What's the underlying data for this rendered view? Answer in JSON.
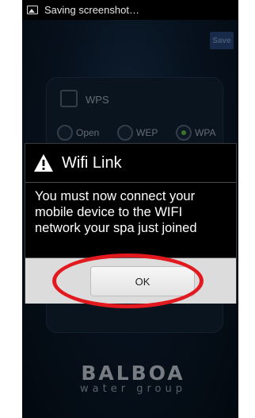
{
  "status_bar": {
    "text": "Saving screenshot…",
    "icon": "screenshot-icon"
  },
  "toolbar": {
    "save_label": "Save"
  },
  "background_form": {
    "wps_label": "WPS",
    "security_options": [
      {
        "label": "Open",
        "selected": false
      },
      {
        "label": "WEP",
        "selected": false
      },
      {
        "label": "WPA",
        "selected": true
      }
    ]
  },
  "dialog": {
    "title": "Wifi Link",
    "message": "You must now connect your mobile device to the WIFI network your spa just joined",
    "ok_label": "OK",
    "icon": "warning-icon"
  },
  "logo": {
    "main": "BALBOA",
    "sub": "water group"
  },
  "colors": {
    "highlight": "#e2191e",
    "accent": "#6ed64b",
    "save_button": "#2c4d86"
  }
}
